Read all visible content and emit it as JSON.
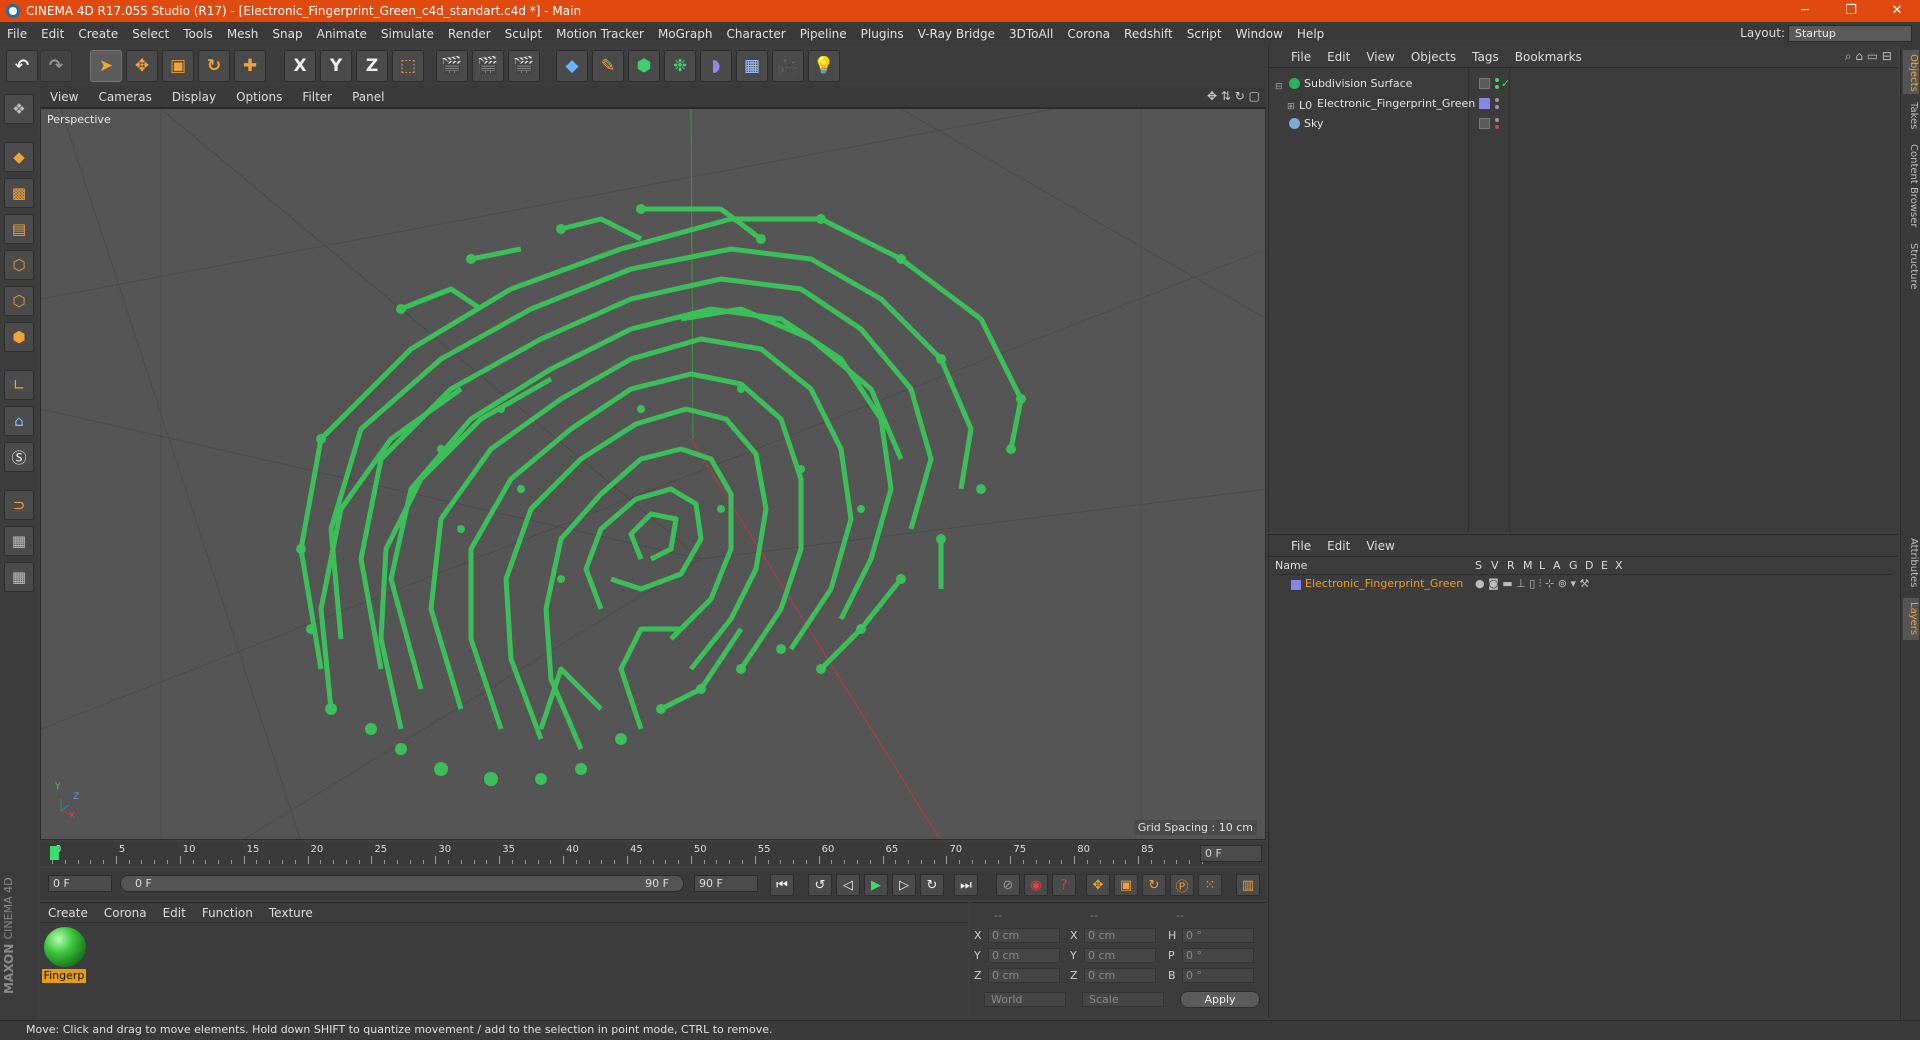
{
  "window": {
    "title": "CINEMA 4D R17.055 Studio (R17) - [Electronic_Fingerprint_Green_c4d_standart.c4d *] - Main",
    "minimize": "─",
    "restore": "❐",
    "close": "✕"
  },
  "menubar": {
    "items": [
      "File",
      "Edit",
      "Create",
      "Select",
      "Tools",
      "Mesh",
      "Snap",
      "Animate",
      "Simulate",
      "Render",
      "Sculpt",
      "Motion Tracker",
      "MoGraph",
      "Character",
      "Pipeline",
      "Plugins",
      "V-Ray Bridge",
      "3DToAll",
      "Corona",
      "Redshift",
      "Script",
      "Window",
      "Help"
    ],
    "layout_label": "Layout:",
    "layout_value": "Startup"
  },
  "toolbar": {
    "axis_x": "X",
    "axis_y": "Y",
    "axis_z": "Z"
  },
  "viewport": {
    "menu": [
      "View",
      "Cameras",
      "Display",
      "Options",
      "Filter",
      "Panel"
    ],
    "label": "Perspective",
    "grid_spacing": "Grid Spacing : 10 cm",
    "axis_labels": {
      "x": "X",
      "y": "Y",
      "z": "Z"
    }
  },
  "timeline": {
    "ticks": [
      "0",
      "5",
      "10",
      "15",
      "20",
      "25",
      "30",
      "35",
      "40",
      "45",
      "50",
      "55",
      "60",
      "65",
      "70",
      "75",
      "80",
      "85",
      "90"
    ],
    "current_frame": "0 F"
  },
  "transport": {
    "start_frame": "0 F",
    "range_start": "0 F",
    "range_end": "90 F",
    "end_frame": "90 F"
  },
  "material_manager": {
    "menu": [
      "Create",
      "Corona",
      "Edit",
      "Function",
      "Texture"
    ],
    "material_name": "Fingerp",
    "brand_line1": "MAXON",
    "brand_line2": "CINEMA 4D"
  },
  "coordinates": {
    "header": [
      "--",
      "--",
      "--"
    ],
    "rows": [
      {
        "a": "X",
        "av": "0 cm",
        "b": "X",
        "bv": "0 cm",
        "c": "H",
        "cv": "0 °"
      },
      {
        "a": "Y",
        "av": "0 cm",
        "b": "Y",
        "bv": "0 cm",
        "c": "P",
        "cv": "0 °"
      },
      {
        "a": "Z",
        "av": "0 cm",
        "b": "Z",
        "bv": "0 cm",
        "c": "B",
        "cv": "0 °"
      }
    ],
    "world": "World",
    "scale": "Scale",
    "apply": "Apply"
  },
  "object_manager": {
    "menu": [
      "File",
      "Edit",
      "View",
      "Objects",
      "Tags",
      "Bookmarks"
    ],
    "objects": [
      {
        "name": "Subdivision Surface",
        "color": "#2fb05a"
      },
      {
        "name": "Electronic_Fingerprint_Green",
        "color": "#aaaaaa"
      },
      {
        "name": "Sky",
        "color": "#7fa9d6"
      }
    ]
  },
  "layer_manager": {
    "menu": [
      "File",
      "Edit",
      "View"
    ],
    "columns": [
      "Name",
      "S",
      "V",
      "R",
      "M",
      "L",
      "A",
      "G",
      "D",
      "E",
      "X"
    ],
    "layer_name": "Electronic_Fingerprint_Green",
    "layer_color": "#8a86e8"
  },
  "side_tabs": [
    "Objects",
    "Takes",
    "Content Browser",
    "Structure",
    "Attributes",
    "Layers"
  ],
  "status": "Move: Click and drag to move elements. Hold down SHIFT to quantize movement / add to the selection in point mode, CTRL to remove."
}
